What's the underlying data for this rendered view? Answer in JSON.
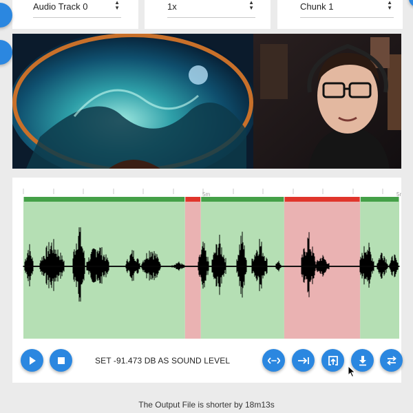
{
  "controls": {
    "audio_track": "Audio Track 0",
    "speed": "1x",
    "chunk": "Chunk 1"
  },
  "timeline": {
    "tick_labels": [
      "5m",
      "5r"
    ]
  },
  "segments": [
    {
      "start_pct": 0.0,
      "end_pct": 43.0,
      "status": "keep"
    },
    {
      "start_pct": 43.0,
      "end_pct": 47.2,
      "status": "cut"
    },
    {
      "start_pct": 47.2,
      "end_pct": 69.4,
      "status": "keep"
    },
    {
      "start_pct": 69.4,
      "end_pct": 89.6,
      "status": "cut"
    },
    {
      "start_pct": 89.6,
      "end_pct": 100.0,
      "status": "keep"
    }
  ],
  "status_message": "SET -91.473 DB AS SOUND LEVEL",
  "footer_message": "The Output File is shorter by 18m13s",
  "colors": {
    "accent": "#2b87e0",
    "keep_bar": "#44a047",
    "keep_fill": "#b5dfb4",
    "cut_bar": "#e0352b",
    "cut_fill": "#eab2b2",
    "waveform": "#000000"
  },
  "icons": {
    "play": "play-icon",
    "stop": "stop-icon",
    "fit": "fit-width-icon",
    "jump_end": "jump-to-end-icon",
    "export": "open-in-app-icon",
    "download": "download-icon",
    "swap": "swap-icon"
  }
}
